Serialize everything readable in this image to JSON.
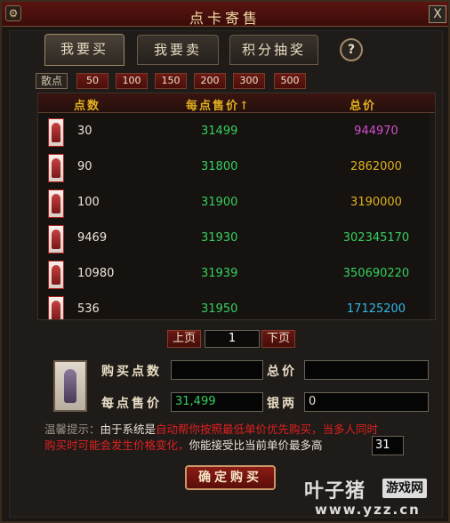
{
  "window": {
    "title": "点卡寄售",
    "close_label": "X",
    "sys_icon": "⚙"
  },
  "tabs": [
    {
      "label": "我要买",
      "active": true
    },
    {
      "label": "我要卖",
      "active": false
    },
    {
      "label": "积分抽奖",
      "active": false
    }
  ],
  "help_label": "?",
  "filter": {
    "label": "散点",
    "options": [
      "50",
      "100",
      "150",
      "200",
      "300",
      "500"
    ]
  },
  "list": {
    "headers": {
      "points": "点数",
      "price": "每点售价↑",
      "total": "总价"
    },
    "rows": [
      {
        "points": "30",
        "price": "31499",
        "total": "944970",
        "total_color": "#d050d0"
      },
      {
        "points": "90",
        "price": "31800",
        "total": "2862000",
        "total_color": "#e0b020"
      },
      {
        "points": "100",
        "price": "31900",
        "total": "3190000",
        "total_color": "#e0b020"
      },
      {
        "points": "9469",
        "price": "31930",
        "total": "302345170",
        "total_color": "#36d060"
      },
      {
        "points": "10980",
        "price": "31939",
        "total": "350690220",
        "total_color": "#36d060"
      },
      {
        "points": "536",
        "price": "31950",
        "total": "17125200",
        "total_color": "#30b8e8"
      }
    ]
  },
  "pager": {
    "prev": "上页",
    "page": "1",
    "next": "下页"
  },
  "buy": {
    "points_label": "购买点数",
    "points_value": "",
    "total_label": "总价",
    "total_value": "",
    "price_label": "每点售价",
    "price_value": "31,499",
    "silver_label": "银两",
    "silver_value": "0"
  },
  "tip": {
    "prefix": "温馨提示：",
    "part1": "由于系统是",
    "red1": "自动帮你按照最低单价优先购买，当多人同时",
    "red2": "购买时可能会发生价格变化，",
    "part2": "你能接受比当前单价最多高",
    "max_qty": "31"
  },
  "confirm_label": "确定购买",
  "watermark": {
    "brand": "叶子猪",
    "badge": "游戏网",
    "url": "www.yzz.cn"
  }
}
